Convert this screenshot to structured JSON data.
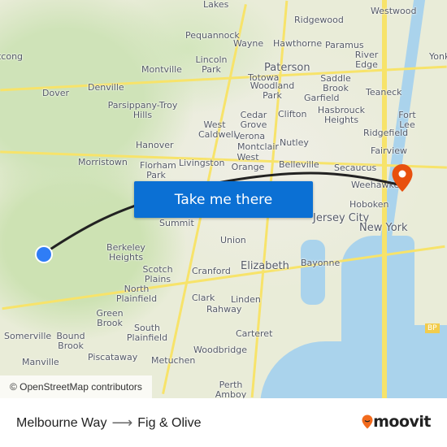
{
  "map": {
    "labels": [
      "Lakes",
      "Ridgewood",
      "Westwood",
      "Pequannock",
      "Wayne",
      "Hawthorne",
      "Paramus",
      "River Edge",
      "Yonkers",
      "Lincoln Park",
      "Montville",
      "Paterson",
      "Totowa",
      "Woodland Park",
      "Saddle Brook",
      "Garfield",
      "Teaneck",
      "Denville",
      "Dover",
      "Parsippany-Troy Hills",
      "Cedar Grove",
      "Clifton",
      "Hasbrouck Heights",
      "Fort Lee",
      "West Caldwell",
      "Verona",
      "Montclair",
      "Nutley",
      "Ridgefield",
      "Fairview",
      "Hanover",
      "Morristown",
      "Florham Park",
      "Livingston",
      "West Orange",
      "Belleville",
      "Secaucus",
      "Weehawken",
      "Hoboken",
      "Jersey City",
      "New York",
      "Summit",
      "Berkeley Heights",
      "Union",
      "Elizabeth",
      "Bayonne",
      "Scotch Plains",
      "Cranford",
      "North Plainfield",
      "Clark",
      "Linden",
      "Rahway",
      "Green Brook",
      "South Plainfield",
      "Carteret",
      "Somerville",
      "Bound Brook",
      "Manville",
      "Piscataway",
      "Metuchen",
      "Woodbridge",
      "Perth Amboy",
      "Netcong",
      "BP"
    ],
    "colors": {
      "water": "#aad3ec",
      "road": "#f7e36a",
      "origin": "#2f7df6",
      "destination": "#e8500e",
      "button": "#0b70d4"
    },
    "attribution": "© OpenStreetMap contributors"
  },
  "action_button": {
    "label": "Take me there"
  },
  "trip": {
    "origin": "Melbourne Way",
    "destination": "Fig & Olive",
    "arrow_icon": "arrow-right-icon"
  },
  "brand": {
    "name": "moovit",
    "icon": "moovit-pin-icon"
  }
}
